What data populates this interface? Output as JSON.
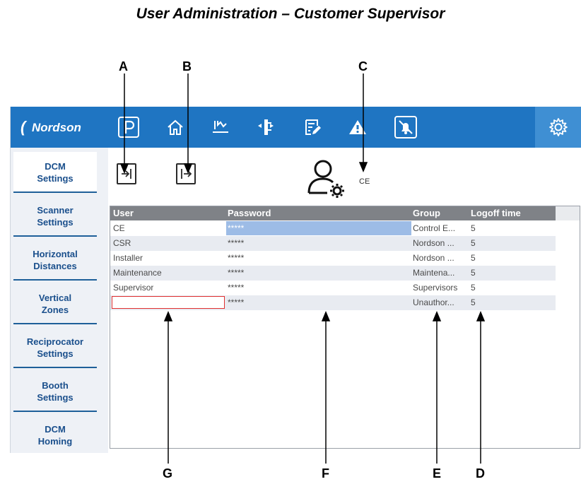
{
  "figure_title": "User Administration – Customer Supervisor",
  "callouts": [
    "A",
    "B",
    "C",
    "D",
    "E",
    "F",
    "G"
  ],
  "app": {
    "logo_text": "Nordson",
    "toolbar_icons": [
      "parking-icon",
      "home-icon",
      "spray-gun-icon",
      "reciprocator-icon",
      "edit-list-icon",
      "warning-icon",
      "alarm-mute-icon",
      "settings-gear-icon"
    ],
    "sidebar": [
      {
        "label": "DCM Settings",
        "active": true
      },
      {
        "label": "Scanner Settings"
      },
      {
        "label": "Horizontal Distances"
      },
      {
        "label": "Vertical Zones"
      },
      {
        "label": "Reciprocator Settings"
      },
      {
        "label": "Booth Settings"
      },
      {
        "label": "DCM Homing"
      }
    ],
    "login_icon": "login-icon",
    "logout_icon": "logout-icon",
    "user_settings_icon": "user-settings-icon",
    "current_user": "CE",
    "table": {
      "columns": [
        "User",
        "Password",
        "Group",
        "Logoff time"
      ],
      "rows": [
        {
          "user": "CE",
          "password": "*****",
          "group": "Control E...",
          "logoff": "5"
        },
        {
          "user": "CSR",
          "password": "*****",
          "group": "Nordson ...",
          "logoff": "5"
        },
        {
          "user": "Installer",
          "password": "*****",
          "group": "Nordson ...",
          "logoff": "5"
        },
        {
          "user": "Maintenance",
          "password": "*****",
          "group": "Maintena...",
          "logoff": "5"
        },
        {
          "user": "Supervisor",
          "password": "*****",
          "group": "Supervisors",
          "logoff": "5"
        },
        {
          "user": "",
          "password": "*****",
          "group": "Unauthor...",
          "logoff": "5"
        }
      ]
    }
  },
  "colors": {
    "toolbar_blue": "#1f75c2",
    "sidebar_text": "#1a4f8c",
    "header_gray": "#7f8287",
    "selection_blue": "#9dbce6",
    "edit_border_red": "#e03030"
  }
}
